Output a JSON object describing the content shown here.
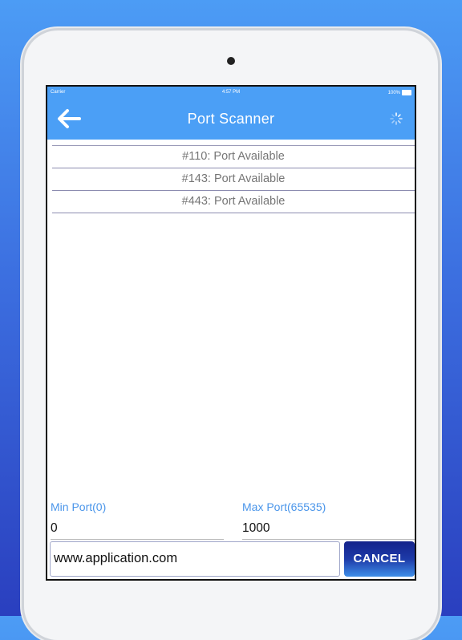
{
  "status_bar": {
    "carrier": "Carrier",
    "time": "4:57 PM",
    "battery": "100%"
  },
  "navbar": {
    "title": "Port Scanner",
    "back_icon": "arrow-left-icon",
    "activity_icon": "spinner-icon"
  },
  "results": [
    {
      "text": "#110: Port Available"
    },
    {
      "text": "#143: Port Available"
    },
    {
      "text": "#443: Port Available"
    }
  ],
  "form": {
    "min_port_label": "Min Port(0)",
    "min_port_value": "0",
    "max_port_label": "Max Port(65535)",
    "max_port_value": "1000",
    "host_value": "www.application.com",
    "cancel_label": "CANCEL"
  },
  "colors": {
    "nav_blue": "#4b9ff6",
    "label_blue": "#4b96ea",
    "button_dark_blue": "#14238b"
  }
}
